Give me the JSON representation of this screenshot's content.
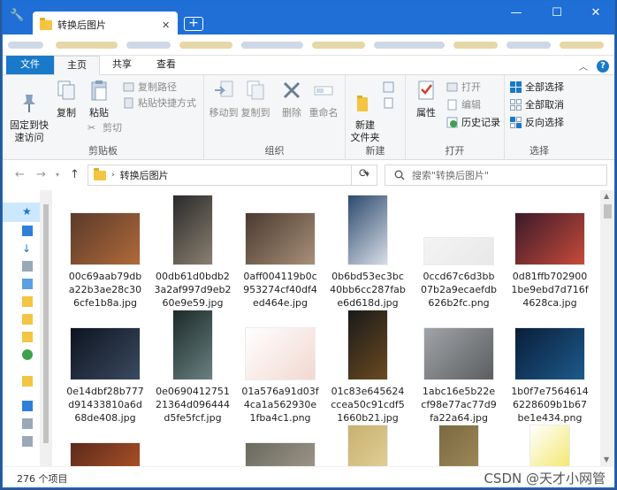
{
  "window": {
    "tab_title": "转换后图片",
    "new_tab": "+",
    "close_tab": "✕",
    "minimize": "—",
    "maximize": "☐",
    "close": "✕"
  },
  "ribbon_tabs": [
    "文件",
    "主页",
    "共享",
    "查看"
  ],
  "ribbon": {
    "clipboard": {
      "pin": "固定到快\n速访问",
      "copy": "复制",
      "paste": "粘贴",
      "copy_path": "复制路径",
      "paste_shortcut": "粘贴快捷方式",
      "cut": "剪切",
      "label": "剪贴板"
    },
    "organize": {
      "move_to": "移动到",
      "copy_to": "复制到",
      "delete": "删除",
      "rename": "重命名",
      "label": "组织"
    },
    "new": {
      "new_folder": "新建\n文件夹",
      "label": "新建"
    },
    "open": {
      "properties": "属性",
      "open": "打开",
      "edit": "编辑",
      "history": "历史记录",
      "label": "打开"
    },
    "select": {
      "select_all": "全部选择",
      "select_none": "全部取消",
      "invert": "反向选择",
      "label": "选择"
    }
  },
  "address": {
    "path": "转换后图片",
    "search_placeholder": "搜索\"转换后图片\""
  },
  "files": [
    {
      "name": "00c69aab79dba22b3ae28c306cfe1b8a.jpg",
      "colors": [
        "#5a3a2a",
        "#b06a3a"
      ],
      "orient": "land"
    },
    {
      "name": "00db61d0bdb23a2af997d9eb260e9e59.jpg",
      "colors": [
        "#2a2a2a",
        "#8a8070"
      ],
      "orient": "port"
    },
    {
      "name": "0aff004119b0c953274cf40df4ed464e.jpg",
      "colors": [
        "#4a3a30",
        "#a89078"
      ],
      "orient": "land"
    },
    {
      "name": "0b6bd53ec3bc40bb6cc287fabe6d618d.jpg",
      "colors": [
        "#2c4a6e",
        "#d8dde6"
      ],
      "orient": "port"
    },
    {
      "name": "0ccd67c6d3bb07b2a9ecaefdb626b2fc.png",
      "colors": [
        "#f4f4f4",
        "#e8e8e8"
      ],
      "orient": "flat"
    },
    {
      "name": "0d81ffb7029001be9ebd7d716f4628ca.jpg",
      "colors": [
        "#3a1a2a",
        "#c84a3a"
      ],
      "orient": "land"
    },
    {
      "name": "0e14dbf28b777d91433810a6d68de408.jpg",
      "colors": [
        "#0e1420",
        "#3a4a60"
      ],
      "orient": "land"
    },
    {
      "name": "0e069041275121364d096444d5fe5fcf.jpg",
      "colors": [
        "#1c2a2a",
        "#6a8080"
      ],
      "orient": "port"
    },
    {
      "name": "01a576a91d03f4ca1a562930e1fba4c1.png",
      "colors": [
        "#ffffff",
        "#f2d8d0"
      ],
      "orient": "land"
    },
    {
      "name": "01c83e645624ccea50c91cdf51660b21.jpg",
      "colors": [
        "#1a1a1a",
        "#6a4a20"
      ],
      "orient": "port"
    },
    {
      "name": "1abc16e5b22ecf98e77ac77d9fa22a64.jpg",
      "colors": [
        "#a0a4a8",
        "#5a5e60"
      ],
      "orient": "land"
    },
    {
      "name": "1b0f7e75646146228609b1b67be1e434.png",
      "colors": [
        "#0a1e3a",
        "#1c5a8a"
      ],
      "orient": "land"
    },
    {
      "name": "",
      "colors": [
        "#5a2a1a",
        "#c05a2a"
      ],
      "orient": "land"
    },
    {
      "name": "",
      "colors": [
        "#ffffff",
        "#ffffff"
      ],
      "orient": "none"
    },
    {
      "name": "",
      "colors": [
        "#6a6a60",
        "#a8a090"
      ],
      "orient": "land"
    },
    {
      "name": "",
      "colors": [
        "#c8b070",
        "#e8d8a0"
      ],
      "orient": "port"
    },
    {
      "name": "",
      "colors": [
        "#7a6a40",
        "#a89060"
      ],
      "orient": "port"
    },
    {
      "name": "",
      "colors": [
        "#ffffff",
        "#f0e040"
      ],
      "orient": "port"
    }
  ],
  "status": {
    "count": "276 个项目",
    "watermark": "CSDN @天才小网管"
  }
}
